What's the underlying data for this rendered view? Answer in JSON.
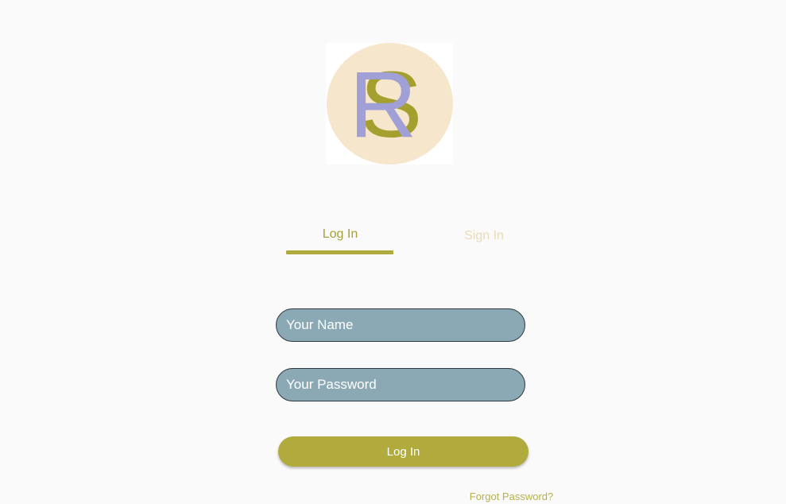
{
  "logo": {
    "icon": "rs-monogram-logo",
    "letter_back": "S",
    "letter_front": "R",
    "circle_color": "#f6e6cc",
    "s_color": "#a49f2e",
    "r_color": "#a09fd6"
  },
  "tabs": {
    "login_label": "Log In",
    "signin_label": "Sign In",
    "active": "login"
  },
  "form": {
    "name_placeholder": "Your Name",
    "name_value": "",
    "password_placeholder": "Your Password",
    "password_value": "",
    "submit_label": "Log In",
    "forgot_label": "Forgot Password?"
  },
  "colors": {
    "accent": "#b1ab3e",
    "field_bg": "#8aa9b4",
    "inactive_tab": "#ecd9b5"
  }
}
